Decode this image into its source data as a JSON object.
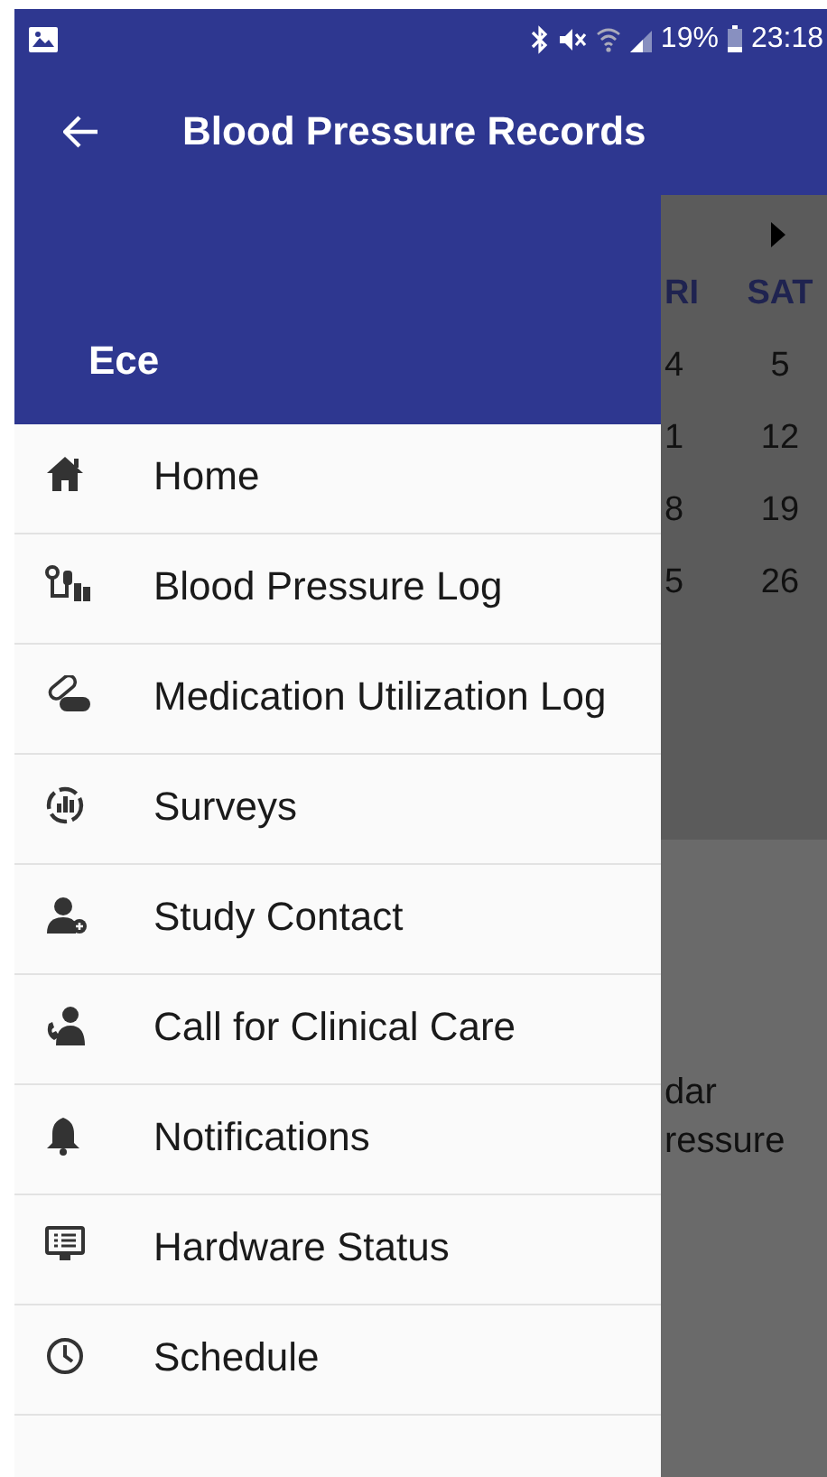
{
  "status_bar": {
    "battery": "19%",
    "time": "23:18"
  },
  "toolbar": {
    "title": "Blood Pressure Records"
  },
  "drawer": {
    "user_name": "Ece",
    "items": [
      {
        "label": "Home"
      },
      {
        "label": "Blood Pressure Log"
      },
      {
        "label": "Medication Utilization Log"
      },
      {
        "label": "Surveys"
      },
      {
        "label": "Study Contact"
      },
      {
        "label": "Call for Clinical Care"
      },
      {
        "label": "Notifications"
      },
      {
        "label": "Hardware Status"
      },
      {
        "label": "Schedule"
      }
    ]
  },
  "calendar": {
    "weekdays": [
      "RI",
      "SAT"
    ],
    "weeks": [
      [
        "4",
        "5"
      ],
      [
        "1",
        "12"
      ],
      [
        "8",
        "19"
      ],
      [
        "5",
        "26"
      ]
    ]
  },
  "legend": {
    "lines": [
      "dar",
      "ressure"
    ]
  }
}
